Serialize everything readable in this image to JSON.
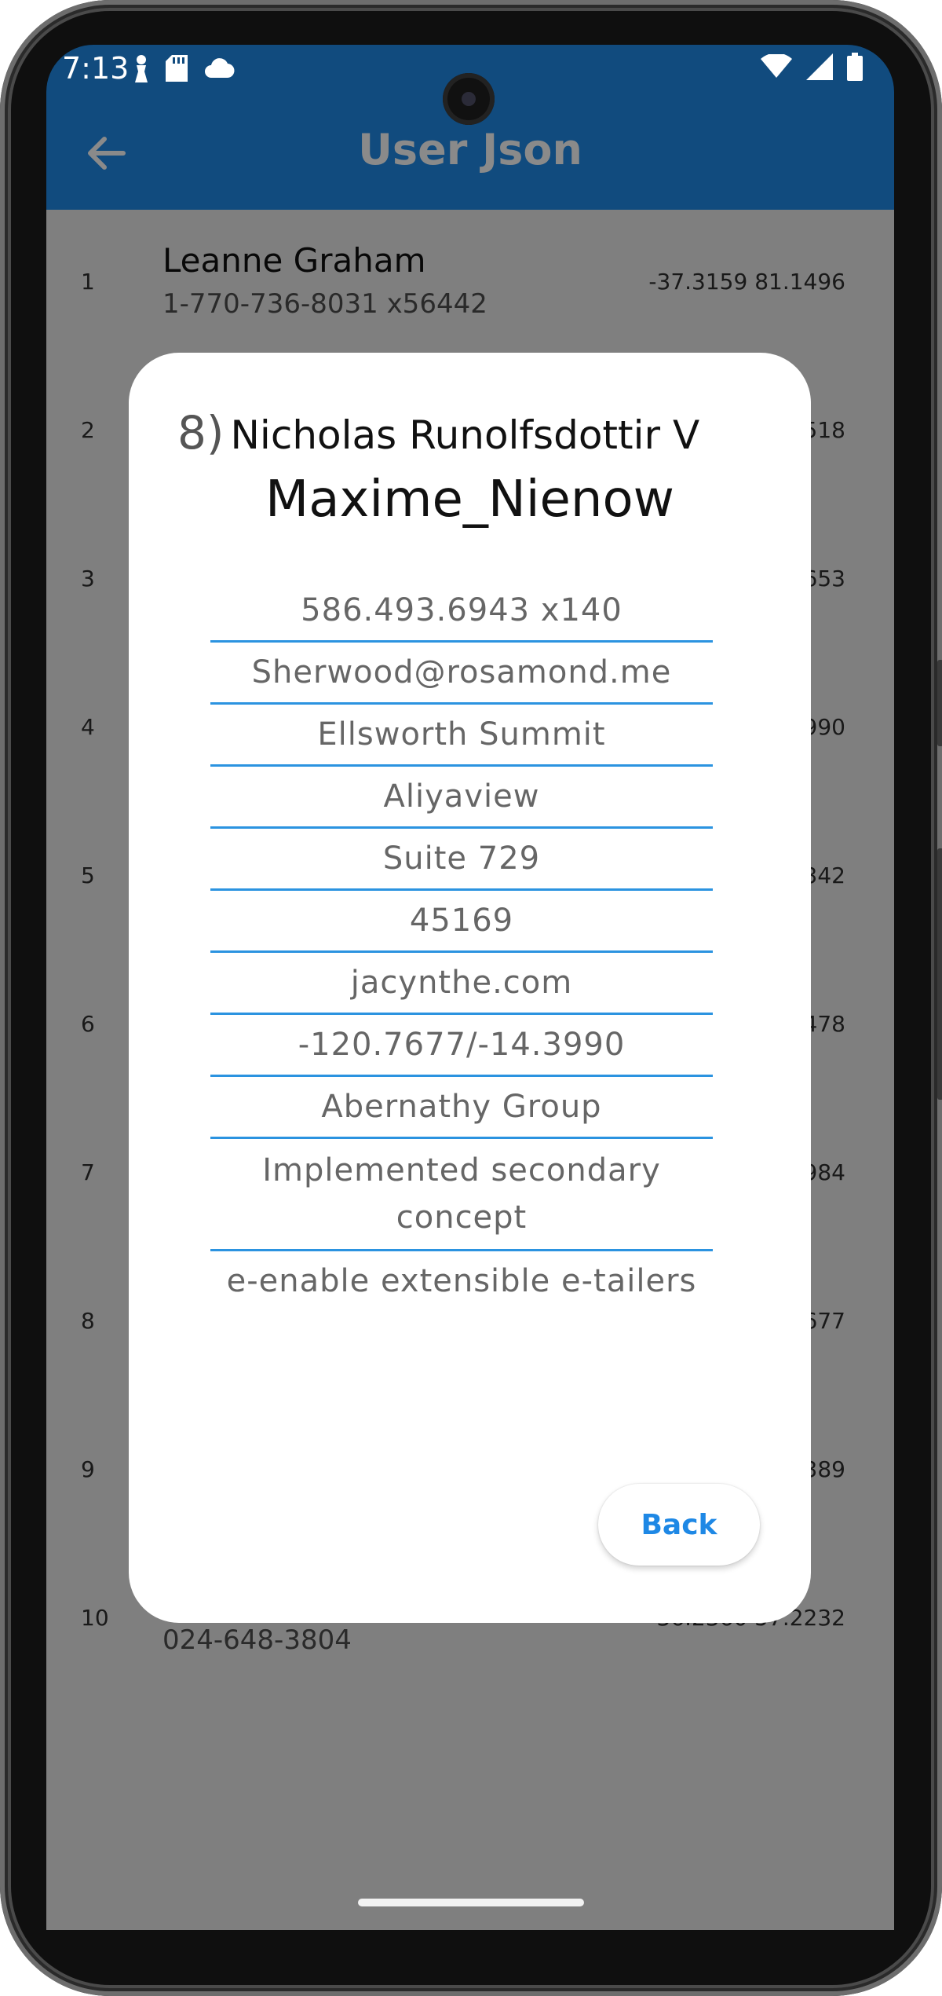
{
  "status_bar": {
    "time": "7:13"
  },
  "app_bar": {
    "title": "User Json",
    "back_icon": "arrow-left-icon"
  },
  "list": {
    "rows": [
      {
        "index": "1",
        "name": "Leanne Graham",
        "phone": "1-770-736-8031 x56442",
        "geo": "-37.3159 81.1496"
      },
      {
        "index": "2",
        "name": "",
        "phone": "",
        "geo": ".518"
      },
      {
        "index": "3",
        "name": "",
        "phone": "",
        "geo": "653"
      },
      {
        "index": "4",
        "name": "",
        "phone": "",
        "geo": "990"
      },
      {
        "index": "5",
        "name": "",
        "phone": "",
        "geo": "342"
      },
      {
        "index": "6",
        "name": "",
        "phone": "",
        "geo": "478"
      },
      {
        "index": "7",
        "name": "",
        "phone": "",
        "geo": "984"
      },
      {
        "index": "8",
        "name": "",
        "phone": "",
        "geo": "677"
      },
      {
        "index": "9",
        "name": "",
        "phone": "",
        "geo": "389"
      },
      {
        "index": "10",
        "name": "",
        "phone": "024-648-3804",
        "geo": "36.2360 57.2232"
      }
    ]
  },
  "dialog": {
    "id_label": "8)",
    "name": "Nicholas Runolfsdottir V",
    "username": "Maxime_Nienow",
    "fields": [
      "586.493.6943 x140",
      "Sherwood@rosamond.me",
      "Ellsworth Summit",
      "Aliyaview",
      "Suite 729",
      "45169",
      "jacynthe.com",
      "-120.7677/-14.3990",
      "Abernathy Group",
      "Implemented secondary concept",
      "e-enable extensible e-tailers"
    ],
    "back_label": "Back"
  },
  "colors": {
    "app_bar": "#114b7e",
    "accent": "#2b93e0",
    "button_text": "#1e88e5"
  }
}
